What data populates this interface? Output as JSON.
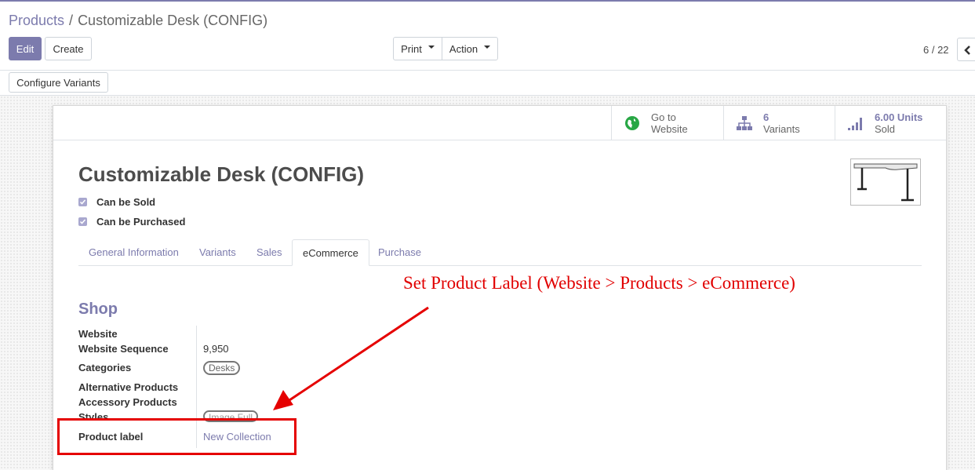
{
  "breadcrumb": {
    "parent": "Products",
    "separator": "/",
    "current": "Customizable Desk (CONFIG)"
  },
  "toolbar": {
    "edit_label": "Edit",
    "create_label": "Create",
    "print_label": "Print",
    "action_label": "Action",
    "configure_variants_label": "Configure Variants"
  },
  "pager": {
    "value": "6 / 22"
  },
  "smart_buttons": [
    {
      "icon": "globe-icon",
      "line1": "Go to",
      "line2": "Website"
    },
    {
      "icon": "sitemap-icon",
      "line1": "6",
      "line2": "Variants"
    },
    {
      "icon": "signal-icon",
      "line1": "6.00 Units",
      "line2": "Sold"
    }
  ],
  "product": {
    "title": "Customizable Desk (CONFIG)",
    "can_be_sold": "Can be Sold",
    "can_be_purchased": "Can be Purchased"
  },
  "tabs": [
    "General Information",
    "Variants",
    "Sales",
    "eCommerce",
    "Purchase"
  ],
  "active_tab": "eCommerce",
  "shop": {
    "title": "Shop",
    "fields": {
      "website": {
        "label": "Website",
        "value": ""
      },
      "website_sequence": {
        "label": "Website Sequence",
        "value": "9,950"
      },
      "categories": {
        "label": "Categories",
        "value": "Desks"
      },
      "alternative_products": {
        "label": "Alternative Products",
        "value": ""
      },
      "accessory_products": {
        "label": "Accessory Products",
        "value": ""
      },
      "styles": {
        "label": "Styles",
        "value": "Image Full"
      },
      "product_label": {
        "label": "Product label",
        "value": "New Collection"
      }
    }
  },
  "annotation": {
    "text": "Set Product Label (Website > Products > eCommerce)",
    "color": "#e10000"
  },
  "colors": {
    "accent": "#7c7bad",
    "annotation_red": "#e50000"
  }
}
